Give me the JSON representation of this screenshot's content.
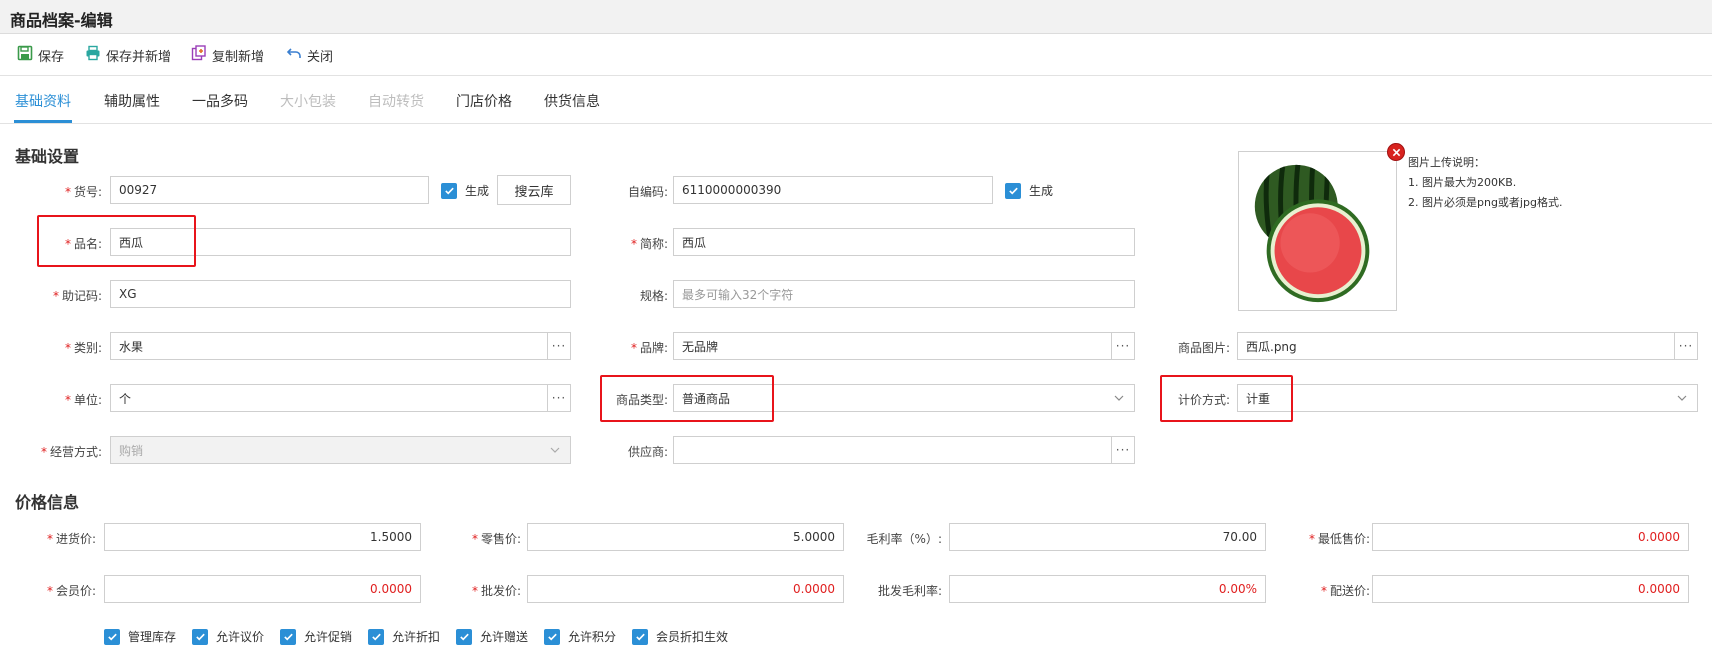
{
  "window": {
    "title": "商品档案-编辑"
  },
  "toolbar": {
    "save": "保存",
    "save_new": "保存并新增",
    "copy_new": "复制新增",
    "close": "关闭"
  },
  "tabs": [
    {
      "label": "基础资料",
      "state": "active"
    },
    {
      "label": "辅助属性",
      "state": "normal"
    },
    {
      "label": "一品多码",
      "state": "normal"
    },
    {
      "label": "大小包装",
      "state": "disabled"
    },
    {
      "label": "自动转货",
      "state": "disabled"
    },
    {
      "label": "门店价格",
      "state": "normal"
    },
    {
      "label": "供货信息",
      "state": "normal"
    }
  ],
  "basic": {
    "section_title": "基础设置",
    "item_no": {
      "label": "货号:",
      "value": "00927",
      "gen_label": "生成"
    },
    "cloud_button": "搜云库",
    "self_code": {
      "label": "自编码:",
      "value": "6110000000390",
      "gen_label": "生成"
    },
    "name": {
      "label": "品名:",
      "value": "西瓜"
    },
    "short_name": {
      "label": "简称:",
      "value": "西瓜"
    },
    "mnemonic": {
      "label": "助记码:",
      "value": "XG"
    },
    "spec": {
      "label": "规格:",
      "placeholder": "最多可输入32个字符"
    },
    "category": {
      "label": "类别:",
      "value": "水果"
    },
    "brand": {
      "label": "品牌:",
      "value": "无品牌"
    },
    "picture": {
      "label": "商品图片:",
      "value": "西瓜.png"
    },
    "unit": {
      "label": "单位:",
      "value": "个"
    },
    "goods_type": {
      "label": "商品类型:",
      "value": "普通商品"
    },
    "pricing": {
      "label": "计价方式:",
      "value": "计重"
    },
    "business_mode": {
      "label": "经营方式:",
      "value": "购销"
    },
    "supplier": {
      "label": "供应商:",
      "value": ""
    },
    "more_glyph": "···"
  },
  "image_note": {
    "title": "图片上传说明：",
    "line1": "1. 图片最大为200KB.",
    "line2": "2. 图片必须是png或者jpg格式."
  },
  "price": {
    "section_title": "价格信息",
    "purchase": {
      "label": "进货价:",
      "value": "1.5000"
    },
    "retail": {
      "label": "零售价:",
      "value": "5.0000"
    },
    "margin": {
      "label": "毛利率（%）:",
      "value": "70.00"
    },
    "min_price": {
      "label": "最低售价:",
      "value": "0.0000"
    },
    "member": {
      "label": "会员价:",
      "value": "0.0000"
    },
    "wholesale": {
      "label": "批发价:",
      "value": "0.0000"
    },
    "wholesale_margin": {
      "label": "批发毛利率:",
      "value": "0.00%"
    },
    "delivery": {
      "label": "配送价:",
      "value": "0.0000"
    }
  },
  "options": [
    {
      "label": "管理库存",
      "checked": true
    },
    {
      "label": "允许议价",
      "checked": true
    },
    {
      "label": "允许促销",
      "checked": true
    },
    {
      "label": "允许折扣",
      "checked": true
    },
    {
      "label": "允许赠送",
      "checked": true
    },
    {
      "label": "允许积分",
      "checked": true
    },
    {
      "label": "会员折扣生效",
      "checked": true
    }
  ],
  "colors": {
    "accent": "#2b8fd6",
    "highlight": "#e8141b",
    "required": "#e02020"
  }
}
